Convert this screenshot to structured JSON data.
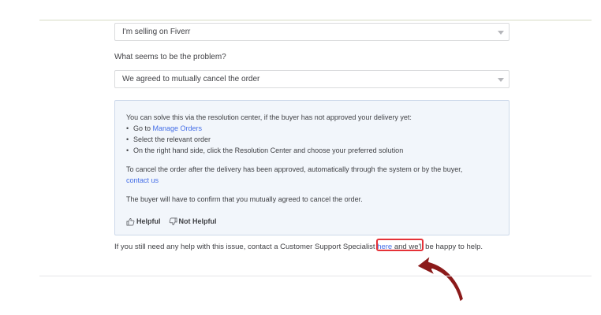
{
  "form": {
    "role_select": {
      "value": "I'm selling on Fiverr"
    },
    "problem_question": "What seems to be the problem?",
    "problem_select": {
      "value": "We agreed to mutually cancel the order"
    }
  },
  "answer_panel": {
    "intro": "You can solve this via the resolution center, if the buyer has not approved your delivery yet:",
    "steps": [
      {
        "prefix": "Go to ",
        "link": "Manage Orders"
      },
      {
        "text": "Select the relevant order"
      },
      {
        "text": "On the right hand side, click the Resolution Center and choose your preferred solution"
      }
    ],
    "cancel_text": "To cancel the order after the delivery has been approved, automatically through the system or by the buyer,",
    "cancel_link": "contact us",
    "confirm_text": "The buyer will have to confirm that you mutually agreed to cancel the order.",
    "helpful_label": "Helpful",
    "not_helpful_label": "Not Helpful"
  },
  "footer": {
    "before": "If you still need any help with this issue, contact a Customer Support Specialist ",
    "link": "here",
    "after": " and we'll be happy to help."
  },
  "colors": {
    "link": "#446ee7",
    "highlight": "#e53238",
    "arrow": "#8b1a1a",
    "panel_bg": "#f2f6fb"
  },
  "icons": [
    "caret-down-icon",
    "thumbs-up-icon",
    "thumbs-down-icon",
    "curved-arrow-icon"
  ]
}
